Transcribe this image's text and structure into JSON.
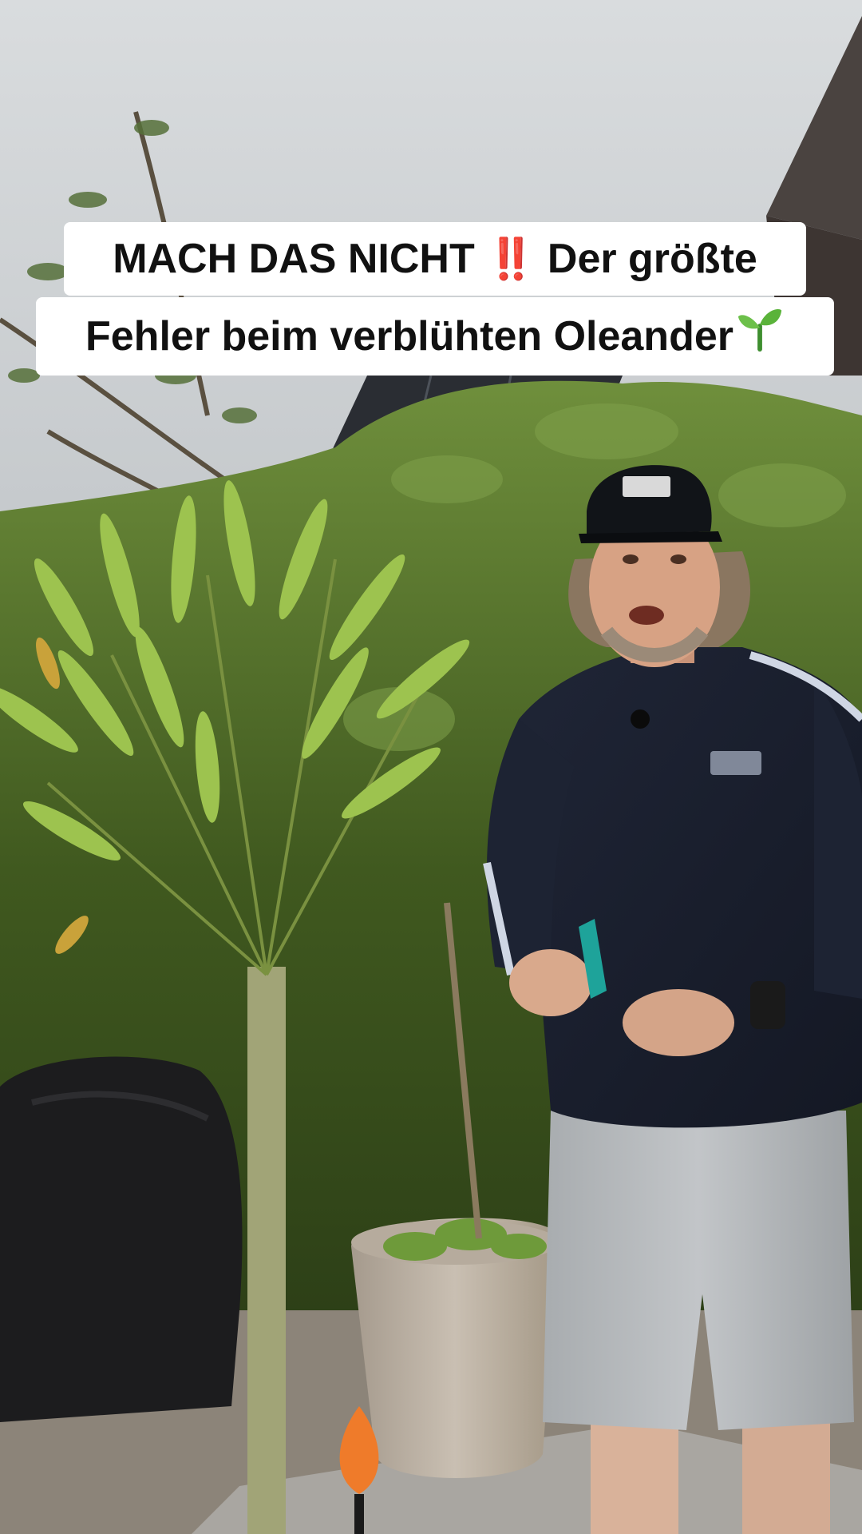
{
  "caption": {
    "line1_text": "MACH DAS NICHT",
    "line1_emoji": "‼️",
    "line1_tail": "Der größte",
    "line2_text": "Fehler beim verblühten Oleander",
    "line2_emoji_name": "seedling-icon"
  },
  "colors": {
    "caption_bg": "#ffffff",
    "caption_text": "#111111",
    "emphasis": "#e3232c"
  }
}
